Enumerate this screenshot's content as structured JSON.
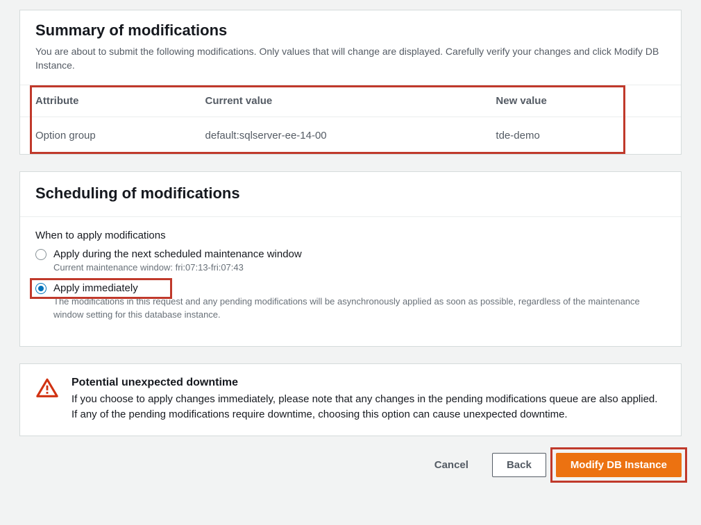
{
  "summary": {
    "title": "Summary of modifications",
    "description": "You are about to submit the following modifications. Only values that will change are displayed. Carefully verify your changes and click Modify DB Instance.",
    "columns": {
      "attribute": "Attribute",
      "current": "Current value",
      "new": "New value"
    },
    "row": {
      "attribute": "Option group",
      "current": "default:sqlserver-ee-14-00",
      "new": "tde-demo"
    }
  },
  "scheduling": {
    "title": "Scheduling of modifications",
    "question": "When to apply modifications",
    "options": [
      {
        "label": "Apply during the next scheduled maintenance window",
        "help": "Current maintenance window: fri:07:13-fri:07:43",
        "selected": false
      },
      {
        "label": "Apply immediately",
        "help": "The modifications in this request and any pending modifications will be asynchronously applied as soon as possible, regardless of the maintenance window setting for this database instance.",
        "selected": true
      }
    ]
  },
  "warning": {
    "title": "Potential unexpected downtime",
    "text": "If you choose to apply changes immediately, please note that any changes in the pending modifications queue are also applied. If any of the pending modifications require downtime, choosing this option can cause unexpected downtime."
  },
  "buttons": {
    "cancel": "Cancel",
    "back": "Back",
    "modify": "Modify DB Instance"
  }
}
